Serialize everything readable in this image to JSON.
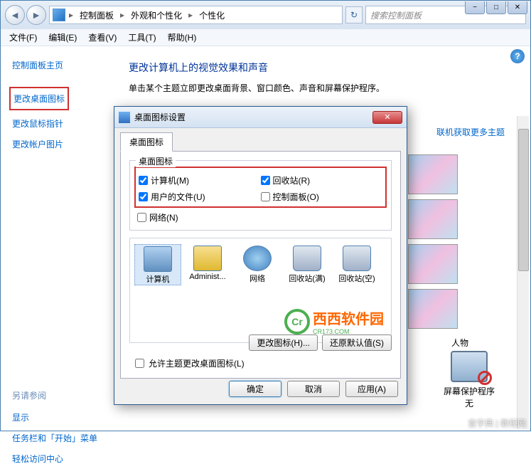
{
  "window_controls": {
    "min": "−",
    "max": "□",
    "close": "✕"
  },
  "breadcrumb": {
    "items": [
      "控制面板",
      "外观和个性化",
      "个性化"
    ],
    "sep": "▸"
  },
  "refresh_glyph": "↻",
  "search": {
    "placeholder": "搜索控制面板"
  },
  "menu": [
    "文件(F)",
    "编辑(E)",
    "查看(V)",
    "工具(T)",
    "帮助(H)"
  ],
  "sidebar": {
    "home": "控制面板主页",
    "links": [
      "更改桌面图标",
      "更改鼠标指针",
      "更改帐户图片"
    ],
    "see_also_label": "另请参阅",
    "see_also": [
      "显示",
      "任务栏和「开始」菜单",
      "轻松访问中心"
    ]
  },
  "main": {
    "title": "更改计算机上的视觉效果和声音",
    "desc": "单击某个主题立即更改桌面背景、窗口颜色、声音和屏幕保护程序。",
    "theme_link": "联机获取更多主题",
    "theme_category": "人物",
    "screensaver_label": "屏幕保护程序",
    "screensaver_value": "无",
    "help_glyph": "?"
  },
  "dialog": {
    "title": "桌面图标设置",
    "close_glyph": "✕",
    "tab": "桌面图标",
    "group_label": "桌面图标",
    "checks": [
      {
        "label": "计算机(M)",
        "checked": true
      },
      {
        "label": "回收站(R)",
        "checked": true
      },
      {
        "label": "用户的文件(U)",
        "checked": true
      },
      {
        "label": "控制面板(O)",
        "checked": false
      },
      {
        "label": "网络(N)",
        "checked": false
      }
    ],
    "icons": [
      "计算机",
      "Administ...",
      "网络",
      "回收站(满)",
      "回收站(空)"
    ],
    "change_icon_btn": "更改图标(H)...",
    "restore_btn": "还原默认值(S)",
    "allow_theme": "允许主题更改桌面图标(L)",
    "allow_theme_checked": false,
    "ok": "确定",
    "cancel": "取消",
    "apply": "应用(A)"
  },
  "watermark": {
    "circle": "Cr",
    "text": "西西软件园",
    "sub": "CR173.COM"
  },
  "footer": "查字典 | 教程网"
}
